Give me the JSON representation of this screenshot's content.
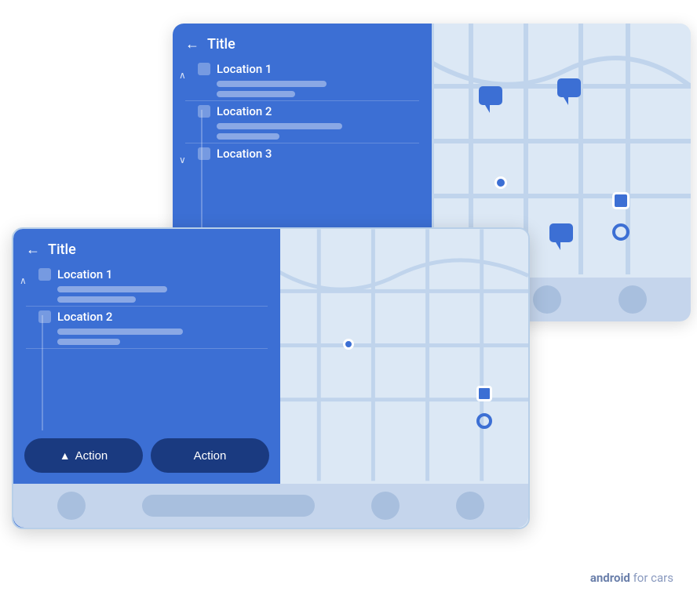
{
  "back_card": {
    "title": "Title",
    "locations": [
      {
        "name": "Location 1",
        "lines": [
          "long",
          "medium"
        ],
        "expanded": true
      },
      {
        "name": "Location 2",
        "lines": [
          "xlong",
          "short"
        ],
        "expanded": false
      },
      {
        "name": "Location 3",
        "lines": [],
        "expanded": false
      }
    ]
  },
  "front_card": {
    "title": "Title",
    "locations": [
      {
        "name": "Location 1",
        "lines": [
          "long",
          "medium"
        ],
        "expanded": true
      },
      {
        "name": "Location 2",
        "lines": [
          "xlong",
          "short"
        ],
        "expanded": false
      }
    ],
    "actions": [
      {
        "label": "Action",
        "icon": "navigation"
      },
      {
        "label": "Action",
        "icon": null
      }
    ]
  },
  "branding": {
    "bold": "android",
    "normal": " for cars"
  }
}
